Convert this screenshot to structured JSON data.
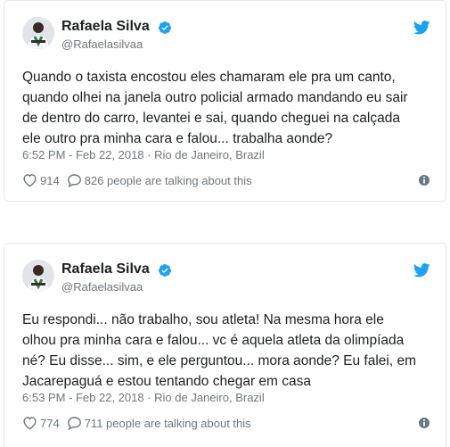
{
  "tweets": [
    {
      "author_name": "Rafaela Silva",
      "handle": "@Rafaelasilvaa",
      "text_lines": [
        "Quando o taxista encostou eles chamaram ele pra um canto,",
        "quando olhei na janela outro policial armado mandando eu sair",
        "de dentro do carro, levantei e sai, quando cheguei na calçada",
        "ele outro pra minha cara e falou... trabalha aonde?"
      ],
      "timestamp": "6:52 PM - Feb 22, 2018",
      "location": "Rio de Janeiro, Brazil",
      "likes": "914",
      "talking": "826 people are talking about this"
    },
    {
      "author_name": "Rafaela Silva",
      "handle": "@Rafaelasilvaa",
      "text_lines": [
        "Eu respondi... não trabalho, sou atleta! Na mesma hora ele",
        "olhou pra minha cara e falou... vc é aquela atleta da olimpíada",
        "né? Eu disse... sim, e ele perguntou... mora aonde? Eu falei, em",
        "Jacarepaguá e estou tentando chegar em casa"
      ],
      "timestamp": "6:53 PM - Feb 22, 2018",
      "location": "Rio de Janeiro, Brazil",
      "likes": "774",
      "talking": "711 people are talking about this"
    }
  ],
  "meta_separator": " · ",
  "colors": {
    "text": "#1c2022",
    "muted": "#697882",
    "border": "#e1e8ed",
    "twitter_blue": "#1da1f2",
    "verified_blue": "#1da1f2"
  },
  "icons": [
    "verified-badge-icon",
    "twitter-bird-icon",
    "heart-icon",
    "reply-bubble-icon",
    "info-icon"
  ]
}
